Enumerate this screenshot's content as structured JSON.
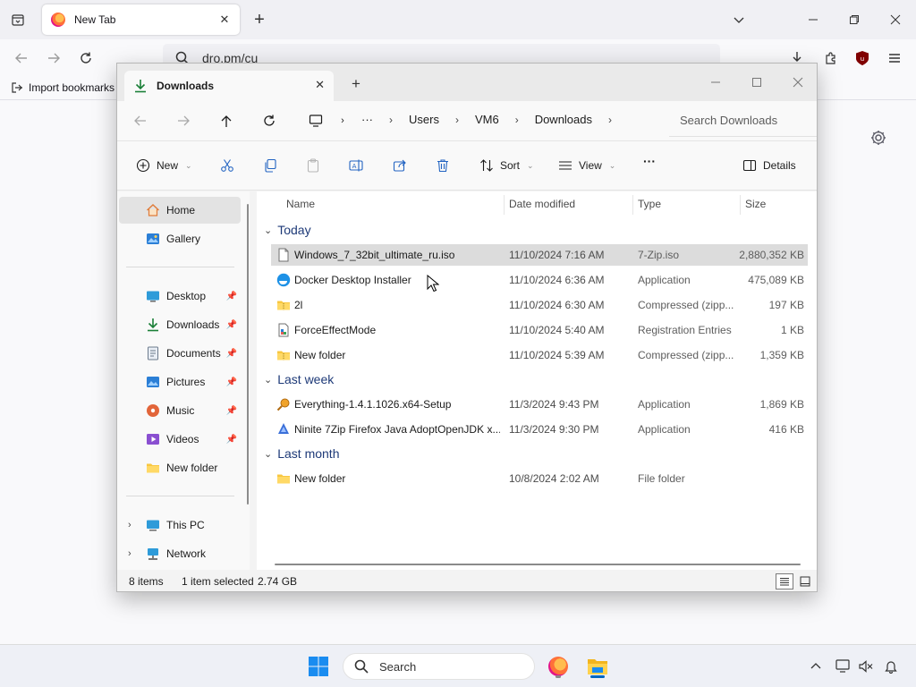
{
  "browser": {
    "tab_title": "New Tab",
    "url": "dro.pm/cu",
    "bookmark_import": "Import bookmarks"
  },
  "explorer": {
    "tab_title": "Downloads",
    "breadcrumb": [
      "Users",
      "VM6",
      "Downloads"
    ],
    "breadcrumb_more": "···",
    "search_placeholder": "Search Downloads",
    "toolbar": {
      "new_label": "New",
      "sort_label": "Sort",
      "view_label": "View",
      "more_label": "···",
      "details_label": "Details"
    },
    "sidebar": {
      "home": "Home",
      "gallery": "Gallery",
      "pinned": [
        "Desktop",
        "Downloads",
        "Documents",
        "Pictures",
        "Music",
        "Videos"
      ],
      "new_folder": "New folder",
      "this_pc": "This PC",
      "network": "Network"
    },
    "columns": {
      "name": "Name",
      "date": "Date modified",
      "type": "Type",
      "size": "Size"
    },
    "groups": {
      "today": "Today",
      "last_week": "Last week",
      "last_month": "Last month"
    },
    "files_today": [
      {
        "name": "Windows_7_32bit_ultimate_ru.iso",
        "date": "11/10/2024 7:16 AM",
        "type": "7-Zip.iso",
        "size": "2,880,352 KB",
        "icon": "iso-file-icon"
      },
      {
        "name": "Docker Desktop Installer",
        "date": "11/10/2024 6:36 AM",
        "type": "Application",
        "size": "475,089 KB",
        "icon": "docker-icon"
      },
      {
        "name": "2l",
        "date": "11/10/2024 6:30 AM",
        "type": "Compressed (zipp...",
        "size": "197 KB",
        "icon": "zip-folder-icon"
      },
      {
        "name": "ForceEffectMode",
        "date": "11/10/2024 5:40 AM",
        "type": "Registration Entries",
        "size": "1 KB",
        "icon": "registry-icon"
      },
      {
        "name": "New folder",
        "date": "11/10/2024 5:39 AM",
        "type": "Compressed (zipp...",
        "size": "1,359 KB",
        "icon": "zip-folder-icon"
      }
    ],
    "files_last_week": [
      {
        "name": "Everything-1.4.1.1026.x64-Setup",
        "date": "11/3/2024 9:43 PM",
        "type": "Application",
        "size": "1,869 KB",
        "icon": "everything-icon"
      },
      {
        "name": "Ninite 7Zip Firefox Java AdoptOpenJDK x...",
        "date": "11/3/2024 9:30 PM",
        "type": "Application",
        "size": "416 KB",
        "icon": "ninite-icon"
      }
    ],
    "files_last_month": [
      {
        "name": "New folder",
        "date": "10/8/2024 2:02 AM",
        "type": "File folder",
        "size": "",
        "icon": "folder-icon"
      }
    ],
    "status": {
      "items": "8 items",
      "selected": "1 item selected",
      "selected_size": "2.74 GB"
    }
  },
  "taskbar": {
    "search_label": "Search"
  },
  "colors": {
    "accent": "#0067c0",
    "folder": "#f8c740",
    "selected_row": "#dcdcdc"
  }
}
